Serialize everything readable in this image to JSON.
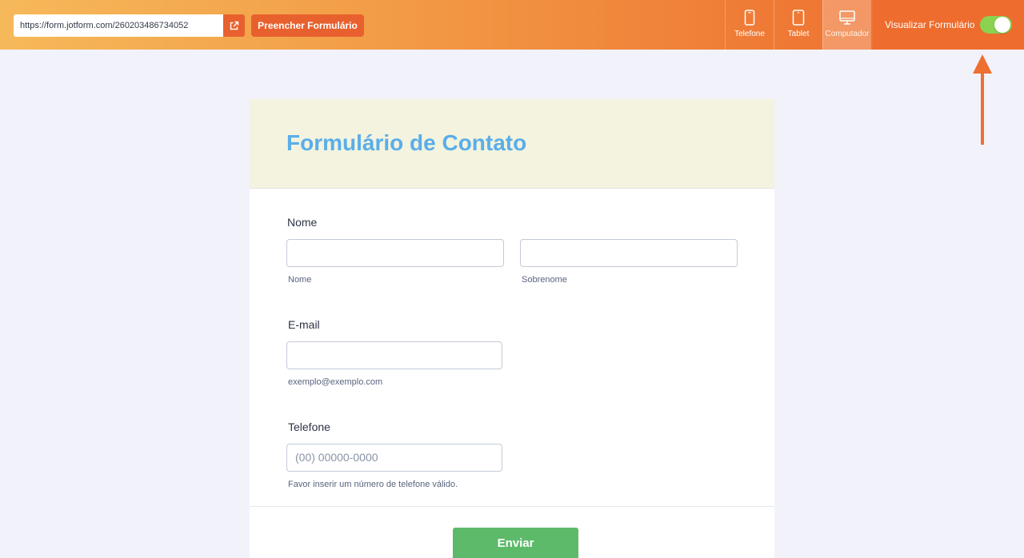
{
  "toolbar": {
    "url": "https://form.jotform.com/260203486734052",
    "open_link_icon": "external-link-icon",
    "fill_button": "Preencher Formulário",
    "devices": [
      {
        "label": "Telefone",
        "icon": "phone-icon",
        "active": false
      },
      {
        "label": "Tablet",
        "icon": "tablet-icon",
        "active": false
      },
      {
        "label": "Computador",
        "icon": "desktop-icon",
        "active": true
      }
    ],
    "preview_label": "Visualizar Formulário",
    "preview_toggle_on": true
  },
  "annotation": {
    "icon": "arrow-up-icon",
    "color": "#ee6f30"
  },
  "form": {
    "title": "Formulário de Contato",
    "name_field": {
      "label": "Nome",
      "first_sublabel": "Nome",
      "last_sublabel": "Sobrenome",
      "first_value": "",
      "last_value": ""
    },
    "email_field": {
      "label": "E-mail",
      "sublabel": "exemplo@exemplo.com",
      "value": ""
    },
    "phone_field": {
      "label": "Telefone",
      "placeholder": "(00) 00000-0000",
      "sublabel": "Favor inserir um número de telefone válido."
    },
    "submit_label": "Enviar"
  },
  "colors": {
    "accent": "#e8602d",
    "title": "#5aaee8",
    "submit": "#5cba6a",
    "toggle_on": "#8ad24f",
    "header_bg": "#f3f3df",
    "page_bg": "#f2f2fb"
  }
}
